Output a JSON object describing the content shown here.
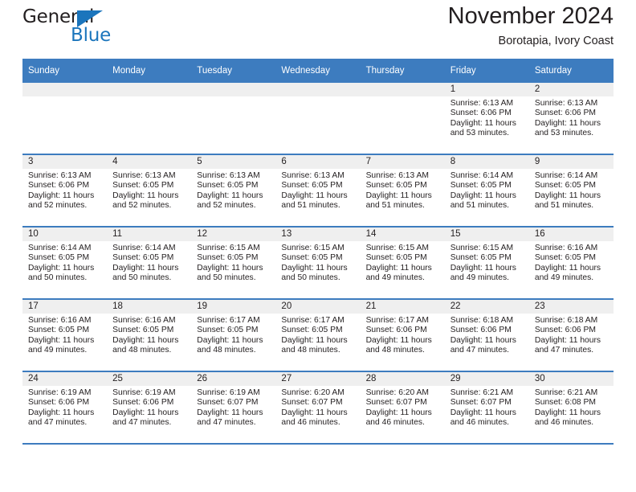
{
  "brand": {
    "word_one": "General",
    "word_two": "Blue",
    "accent_color": "#1b75bc"
  },
  "header": {
    "title": "November 2024",
    "subtitle": "Borotapia, Ivory Coast",
    "header_bg": "#3d7cbf",
    "date_band_bg": "#efefef"
  },
  "weekday_headers": [
    "Sunday",
    "Monday",
    "Tuesday",
    "Wednesday",
    "Thursday",
    "Friday",
    "Saturday"
  ],
  "weeks": [
    [
      {
        "day": "",
        "empty": true
      },
      {
        "day": "",
        "empty": true
      },
      {
        "day": "",
        "empty": true
      },
      {
        "day": "",
        "empty": true
      },
      {
        "day": "",
        "empty": true
      },
      {
        "day": "1",
        "sunrise": "Sunrise: 6:13 AM",
        "sunset": "Sunset: 6:06 PM",
        "daylight": "Daylight: 11 hours and 53 minutes."
      },
      {
        "day": "2",
        "sunrise": "Sunrise: 6:13 AM",
        "sunset": "Sunset: 6:06 PM",
        "daylight": "Daylight: 11 hours and 53 minutes."
      }
    ],
    [
      {
        "day": "3",
        "sunrise": "Sunrise: 6:13 AM",
        "sunset": "Sunset: 6:06 PM",
        "daylight": "Daylight: 11 hours and 52 minutes."
      },
      {
        "day": "4",
        "sunrise": "Sunrise: 6:13 AM",
        "sunset": "Sunset: 6:05 PM",
        "daylight": "Daylight: 11 hours and 52 minutes."
      },
      {
        "day": "5",
        "sunrise": "Sunrise: 6:13 AM",
        "sunset": "Sunset: 6:05 PM",
        "daylight": "Daylight: 11 hours and 52 minutes."
      },
      {
        "day": "6",
        "sunrise": "Sunrise: 6:13 AM",
        "sunset": "Sunset: 6:05 PM",
        "daylight": "Daylight: 11 hours and 51 minutes."
      },
      {
        "day": "7",
        "sunrise": "Sunrise: 6:13 AM",
        "sunset": "Sunset: 6:05 PM",
        "daylight": "Daylight: 11 hours and 51 minutes."
      },
      {
        "day": "8",
        "sunrise": "Sunrise: 6:14 AM",
        "sunset": "Sunset: 6:05 PM",
        "daylight": "Daylight: 11 hours and 51 minutes."
      },
      {
        "day": "9",
        "sunrise": "Sunrise: 6:14 AM",
        "sunset": "Sunset: 6:05 PM",
        "daylight": "Daylight: 11 hours and 51 minutes."
      }
    ],
    [
      {
        "day": "10",
        "sunrise": "Sunrise: 6:14 AM",
        "sunset": "Sunset: 6:05 PM",
        "daylight": "Daylight: 11 hours and 50 minutes."
      },
      {
        "day": "11",
        "sunrise": "Sunrise: 6:14 AM",
        "sunset": "Sunset: 6:05 PM",
        "daylight": "Daylight: 11 hours and 50 minutes."
      },
      {
        "day": "12",
        "sunrise": "Sunrise: 6:15 AM",
        "sunset": "Sunset: 6:05 PM",
        "daylight": "Daylight: 11 hours and 50 minutes."
      },
      {
        "day": "13",
        "sunrise": "Sunrise: 6:15 AM",
        "sunset": "Sunset: 6:05 PM",
        "daylight": "Daylight: 11 hours and 50 minutes."
      },
      {
        "day": "14",
        "sunrise": "Sunrise: 6:15 AM",
        "sunset": "Sunset: 6:05 PM",
        "daylight": "Daylight: 11 hours and 49 minutes."
      },
      {
        "day": "15",
        "sunrise": "Sunrise: 6:15 AM",
        "sunset": "Sunset: 6:05 PM",
        "daylight": "Daylight: 11 hours and 49 minutes."
      },
      {
        "day": "16",
        "sunrise": "Sunrise: 6:16 AM",
        "sunset": "Sunset: 6:05 PM",
        "daylight": "Daylight: 11 hours and 49 minutes."
      }
    ],
    [
      {
        "day": "17",
        "sunrise": "Sunrise: 6:16 AM",
        "sunset": "Sunset: 6:05 PM",
        "daylight": "Daylight: 11 hours and 49 minutes."
      },
      {
        "day": "18",
        "sunrise": "Sunrise: 6:16 AM",
        "sunset": "Sunset: 6:05 PM",
        "daylight": "Daylight: 11 hours and 48 minutes."
      },
      {
        "day": "19",
        "sunrise": "Sunrise: 6:17 AM",
        "sunset": "Sunset: 6:05 PM",
        "daylight": "Daylight: 11 hours and 48 minutes."
      },
      {
        "day": "20",
        "sunrise": "Sunrise: 6:17 AM",
        "sunset": "Sunset: 6:05 PM",
        "daylight": "Daylight: 11 hours and 48 minutes."
      },
      {
        "day": "21",
        "sunrise": "Sunrise: 6:17 AM",
        "sunset": "Sunset: 6:06 PM",
        "daylight": "Daylight: 11 hours and 48 minutes."
      },
      {
        "day": "22",
        "sunrise": "Sunrise: 6:18 AM",
        "sunset": "Sunset: 6:06 PM",
        "daylight": "Daylight: 11 hours and 47 minutes."
      },
      {
        "day": "23",
        "sunrise": "Sunrise: 6:18 AM",
        "sunset": "Sunset: 6:06 PM",
        "daylight": "Daylight: 11 hours and 47 minutes."
      }
    ],
    [
      {
        "day": "24",
        "sunrise": "Sunrise: 6:19 AM",
        "sunset": "Sunset: 6:06 PM",
        "daylight": "Daylight: 11 hours and 47 minutes."
      },
      {
        "day": "25",
        "sunrise": "Sunrise: 6:19 AM",
        "sunset": "Sunset: 6:06 PM",
        "daylight": "Daylight: 11 hours and 47 minutes."
      },
      {
        "day": "26",
        "sunrise": "Sunrise: 6:19 AM",
        "sunset": "Sunset: 6:07 PM",
        "daylight": "Daylight: 11 hours and 47 minutes."
      },
      {
        "day": "27",
        "sunrise": "Sunrise: 6:20 AM",
        "sunset": "Sunset: 6:07 PM",
        "daylight": "Daylight: 11 hours and 46 minutes."
      },
      {
        "day": "28",
        "sunrise": "Sunrise: 6:20 AM",
        "sunset": "Sunset: 6:07 PM",
        "daylight": "Daylight: 11 hours and 46 minutes."
      },
      {
        "day": "29",
        "sunrise": "Sunrise: 6:21 AM",
        "sunset": "Sunset: 6:07 PM",
        "daylight": "Daylight: 11 hours and 46 minutes."
      },
      {
        "day": "30",
        "sunrise": "Sunrise: 6:21 AM",
        "sunset": "Sunset: 6:08 PM",
        "daylight": "Daylight: 11 hours and 46 minutes."
      }
    ]
  ]
}
